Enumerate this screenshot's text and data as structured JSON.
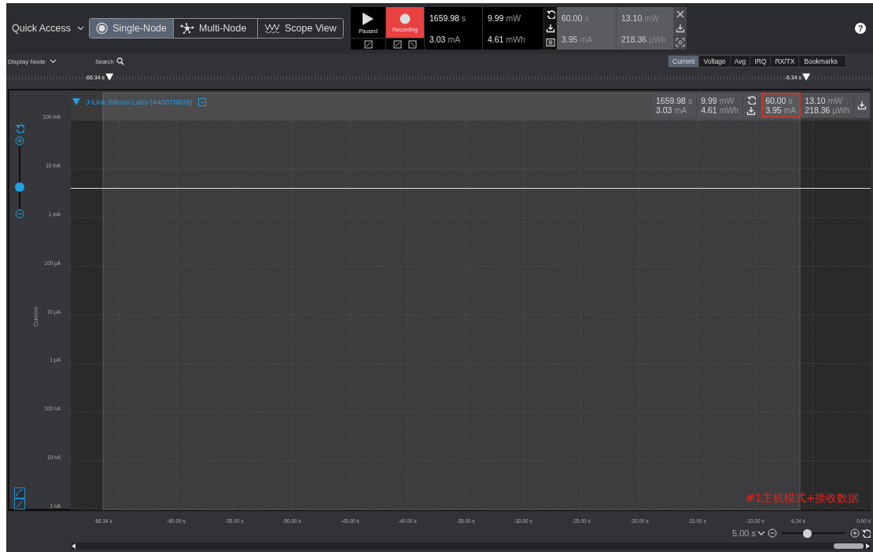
{
  "quick_access": {
    "label": "Quick Access"
  },
  "view_modes": [
    {
      "kind": "single",
      "label": "Single-Node",
      "selected": true
    },
    {
      "kind": "multi",
      "label": "Multi-Node",
      "selected": false
    },
    {
      "kind": "scope",
      "label": "Scope View",
      "selected": false
    }
  ],
  "capture": {
    "playback_label": "Paused",
    "recording_label": "Recording",
    "recording": true
  },
  "live_stats": [
    {
      "value": "1659.98",
      "unit": "s"
    },
    {
      "value": "3.03",
      "unit": "mA"
    },
    {
      "value": "9.99",
      "unit": "mW"
    },
    {
      "value": "4.61",
      "unit": "mWh"
    }
  ],
  "selection_stats": [
    {
      "value": "60.00",
      "unit": "s"
    },
    {
      "value": "3.95",
      "unit": "mA"
    },
    {
      "value": "13.10",
      "unit": "mW"
    },
    {
      "value": "218.36",
      "unit": "µWh"
    }
  ],
  "help": {
    "label": "?"
  },
  "toolbar": {
    "display_node": "Display Node",
    "search": "Search"
  },
  "channel_tabs": [
    {
      "label": "Current",
      "selected": true
    },
    {
      "label": "Voltage",
      "selected": false
    },
    {
      "label": "Avg",
      "selected": false
    },
    {
      "label": "IRQ",
      "selected": false
    },
    {
      "label": "RX/TX",
      "selected": false
    },
    {
      "label": "Bookmarks",
      "selected": false
    }
  ],
  "timeline_markers": [
    {
      "label": "-66.34 s"
    },
    {
      "label": "-6.34 s"
    }
  ],
  "node": {
    "name": "J-Link Silicon Labs (440076938)",
    "expanded": true,
    "stats": [
      {
        "value": "1659.98",
        "unit": "s"
      },
      {
        "value": "3.03",
        "unit": "mA"
      },
      {
        "value": "9.99",
        "unit": "mW"
      },
      {
        "value": "4.61",
        "unit": "mWh"
      }
    ],
    "selection_stats": [
      {
        "value": "60.00",
        "unit": "s"
      },
      {
        "value": "3.95",
        "unit": "mA"
      },
      {
        "value": "13.10",
        "unit": "mW"
      },
      {
        "value": "218.36",
        "unit": "µWh"
      }
    ],
    "selection_highlighted": true
  },
  "vertical_zoom": {
    "level": 0.34
  },
  "plot": {
    "ylabel": "Current",
    "x_labels": [
      "-66.34 s",
      "-60.00 s",
      "-55.00 s",
      "-50.00 s",
      "-45.00 s",
      "-40.00 s",
      "-35.00 s",
      "-30.00 s",
      "-25.00 s",
      "-20.00 s",
      "-15.00 s",
      "-10.00 s",
      "-6.34 s",
      "0.00 s"
    ],
    "y_labels": [
      "100 mA",
      "10 mA",
      "1 mA",
      "100 µA",
      "10 µA",
      "1 µA",
      "100 nA",
      "10 nA",
      "1 nA"
    ]
  },
  "annotation": "#1主机模式+接收数据",
  "time_scale": {
    "value": "5.00 s",
    "level": 0.4
  }
}
